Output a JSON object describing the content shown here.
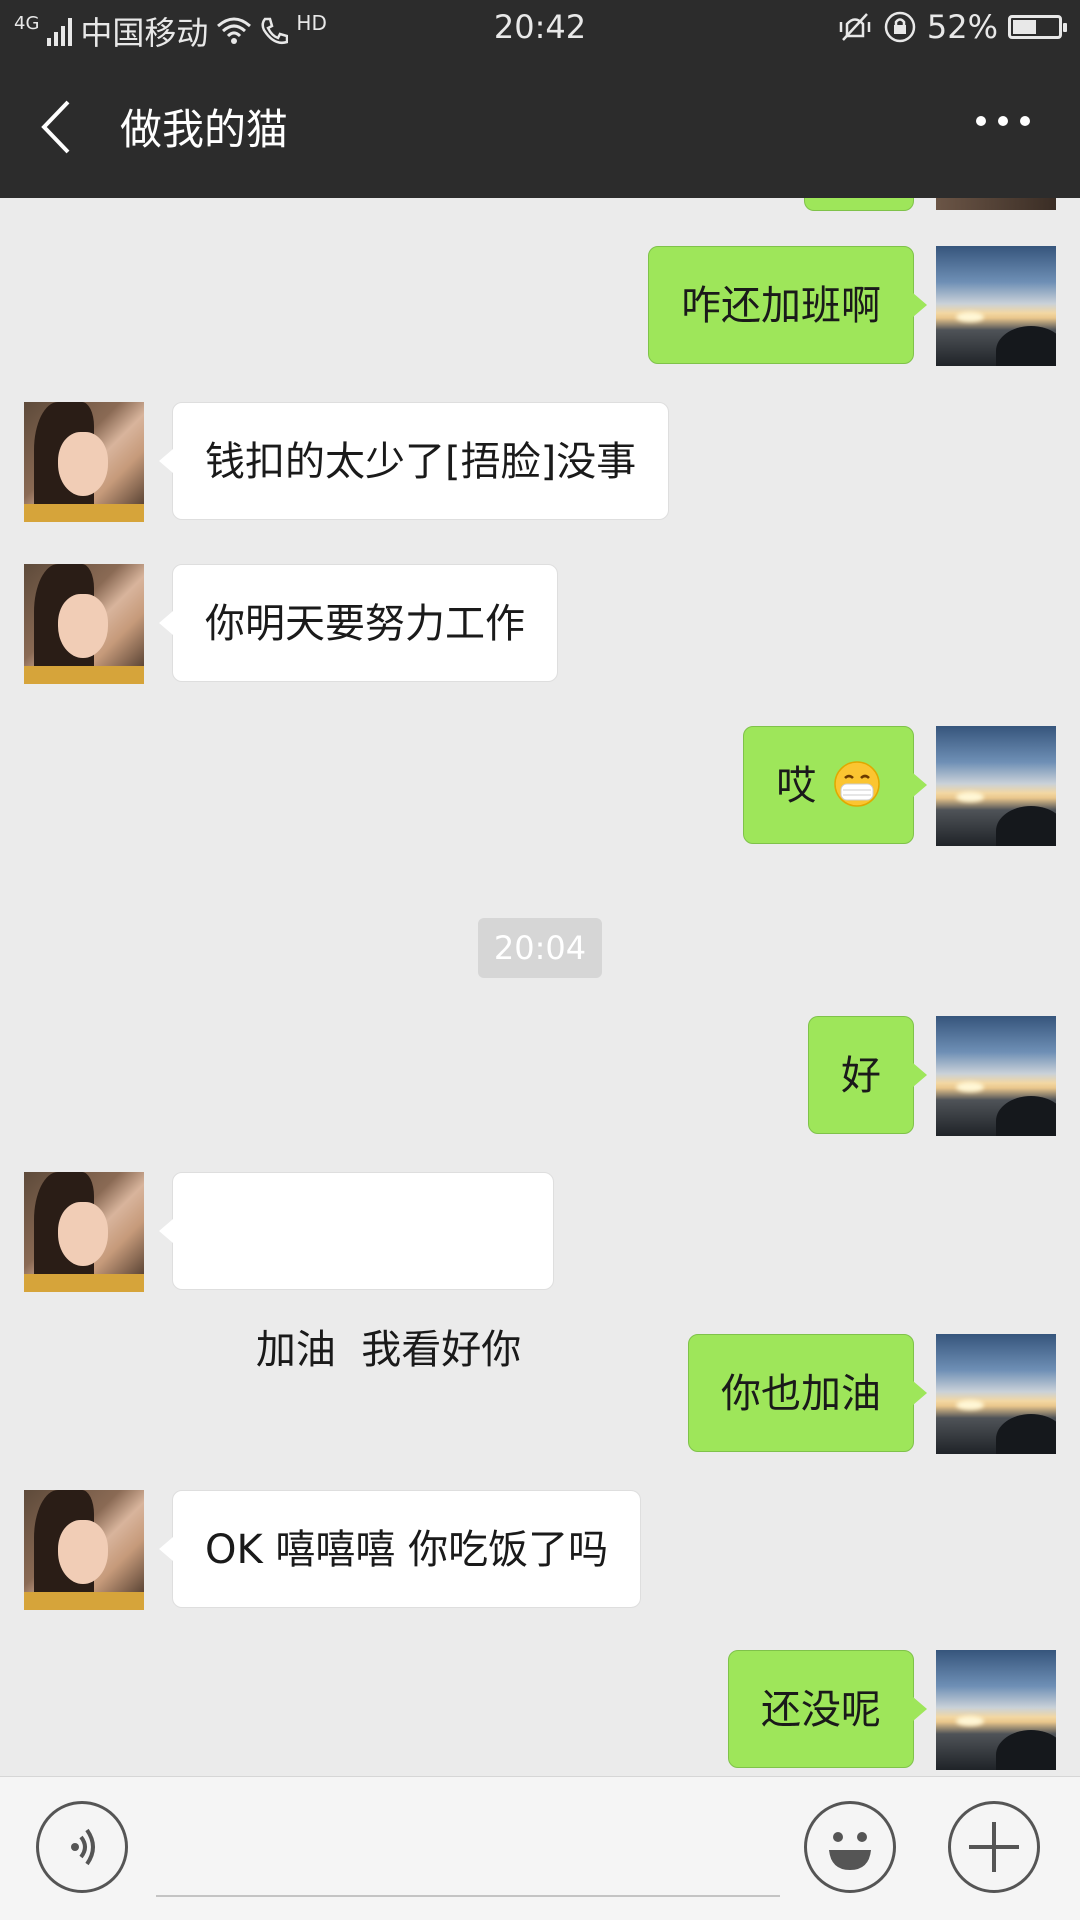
{
  "status_bar": {
    "network": "4G",
    "carrier": "中国移动",
    "hd_label": "HD",
    "time": "20:42",
    "battery_percent": "52%",
    "battery_level": 0.52
  },
  "header": {
    "title": "做我的猫"
  },
  "messages": [
    {
      "sender": "me",
      "text": "咋还加班啊"
    },
    {
      "sender": "them",
      "text": "钱扣的太少了[捂脸]没事"
    },
    {
      "sender": "them",
      "text": "你明天要努力工作"
    },
    {
      "sender": "me",
      "text": "哎",
      "emoji": "mask-face"
    },
    {
      "type": "time",
      "text": "20:04"
    },
    {
      "sender": "me",
      "text": "好"
    },
    {
      "sender": "them",
      "text": "加油  我看好你"
    },
    {
      "sender": "me",
      "text": "你也加油"
    },
    {
      "sender": "them",
      "text": "OK 嘻嘻嘻 你吃饭了吗"
    },
    {
      "sender": "me",
      "text": "还没呢"
    }
  ],
  "input_bar": {
    "voice_icon": "voice-icon",
    "emoji_icon": "smiley-icon",
    "plus_icon": "plus-icon"
  },
  "colors": {
    "bar": "#2c2c2c",
    "chat_background": "#ebebeb",
    "my_bubble": "#9ee65a",
    "their_bubble": "#ffffff"
  }
}
